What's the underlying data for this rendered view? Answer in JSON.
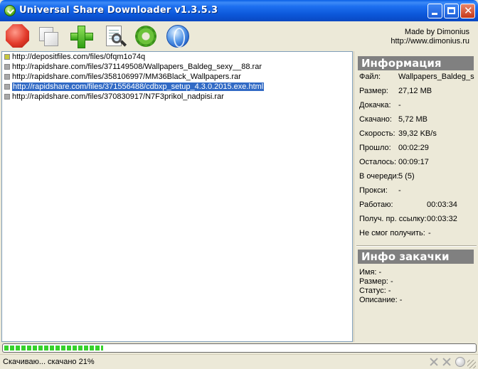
{
  "window": {
    "title": "Universal Share Downloader v1.3.5.3"
  },
  "toolbar": {
    "made_by_line1": "Made by Dimonius",
    "made_by_line2": "http://www.dimonius.ru"
  },
  "downloads": [
    {
      "url": "http://depositfiles.com/files/0fqm1o74q",
      "selected": false,
      "status_color": "#c8c83c"
    },
    {
      "url": "http://rapidshare.com/files/371149508/Wallpapers_Baldeg_sexy__88.rar",
      "selected": false,
      "status_color": "#a8a8a8"
    },
    {
      "url": "http://rapidshare.com/files/358106997/MM36Black_Wallpapers.rar",
      "selected": false,
      "status_color": "#a8a8a8"
    },
    {
      "url": "http://rapidshare.com/files/371556488/cdbxp_setup_4.3.0.2015.exe.html",
      "selected": true,
      "status_color": "#a8a8a8"
    },
    {
      "url": "http://rapidshare.com/files/370830917/N7F3prikol_nadpisi.rar",
      "selected": false,
      "status_color": "#a8a8a8"
    }
  ],
  "info": {
    "header": "Информация",
    "rows": [
      {
        "label": "Файл:",
        "value": "Wallpapers_Baldeg_s"
      },
      {
        "label": "Размер:",
        "value": "27,12 MB"
      },
      {
        "label": "Докачка:",
        "value": "-"
      },
      {
        "label": "Скачано:",
        "value": "5,72 MB"
      },
      {
        "label": "Скорость:",
        "value": "39,32 KB/s"
      },
      {
        "label": "Прошло:",
        "value": "00:02:29"
      },
      {
        "label": "Осталось:",
        "value": "00:09:17"
      },
      {
        "label": "В очереди:",
        "value": "5 (5)"
      },
      {
        "label": "Прокси:",
        "value": "-"
      },
      {
        "label": "Работаю:",
        "value": "00:03:34"
      },
      {
        "label": "Получ. пр. ссылку:",
        "value": "00:03:32"
      },
      {
        "label": "Не смог получить:",
        "value": "-"
      }
    ]
  },
  "download_info": {
    "header": "Инфо закачки",
    "rows": [
      {
        "label": "Имя:",
        "value": "-"
      },
      {
        "label": "Размер:",
        "value": "-"
      },
      {
        "label": "Статус:",
        "value": "-"
      },
      {
        "label": "Описание:",
        "value": "-"
      }
    ]
  },
  "progress": {
    "percent": 21
  },
  "status": {
    "text": "Скачиваю... скачано 21%"
  }
}
